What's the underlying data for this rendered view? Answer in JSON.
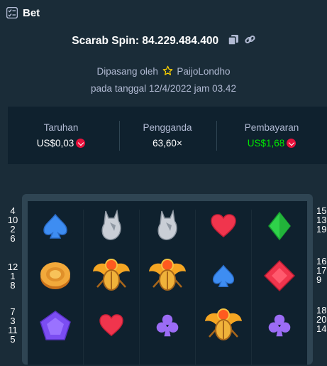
{
  "header": {
    "title": "Bet",
    "icon": "bet-list-icon"
  },
  "spin": {
    "title": "Scarab Spin: 84.229.484.400",
    "copy_icon": "copy-icon",
    "link_icon": "link-icon"
  },
  "placed_by": {
    "prefix": "Dipasang oleh",
    "user": "PaijoLondho",
    "badge_icon": "star-icon"
  },
  "date_text": "pada tanggal 12/4/2022 jam 03.42",
  "stats": {
    "wager_label": "Taruhan",
    "wager_value": "US$0,03",
    "multiplier_label": "Pengganda",
    "multiplier_value": "63,60×",
    "payout_label": "Pembayaran",
    "payout_value": "US$1,68",
    "currency_icon": "tron-coin-icon",
    "payout_color": "#00e701"
  },
  "grid": {
    "rows": [
      [
        "spade",
        "wolf",
        "wolf",
        "heart",
        "diamond"
      ],
      [
        "coin",
        "scarab",
        "scarab",
        "spade",
        "ruby"
      ],
      [
        "pentagon-gem",
        "heart",
        "club",
        "scarab",
        "club"
      ]
    ]
  },
  "left_paylines": [
    [
      "4",
      "10",
      "2",
      "6"
    ],
    [
      "12",
      "1",
      "8"
    ],
    [
      "7",
      "3",
      "11",
      "5"
    ]
  ],
  "right_paylines": [
    [
      "15",
      "13",
      "19"
    ],
    [
      "16",
      "17",
      "9"
    ],
    [
      "18",
      "20",
      "14"
    ]
  ],
  "colors": {
    "background": "#1a2c38",
    "panel": "#0f212e",
    "accent_green": "#00e701",
    "coin_red": "#e9113c"
  }
}
